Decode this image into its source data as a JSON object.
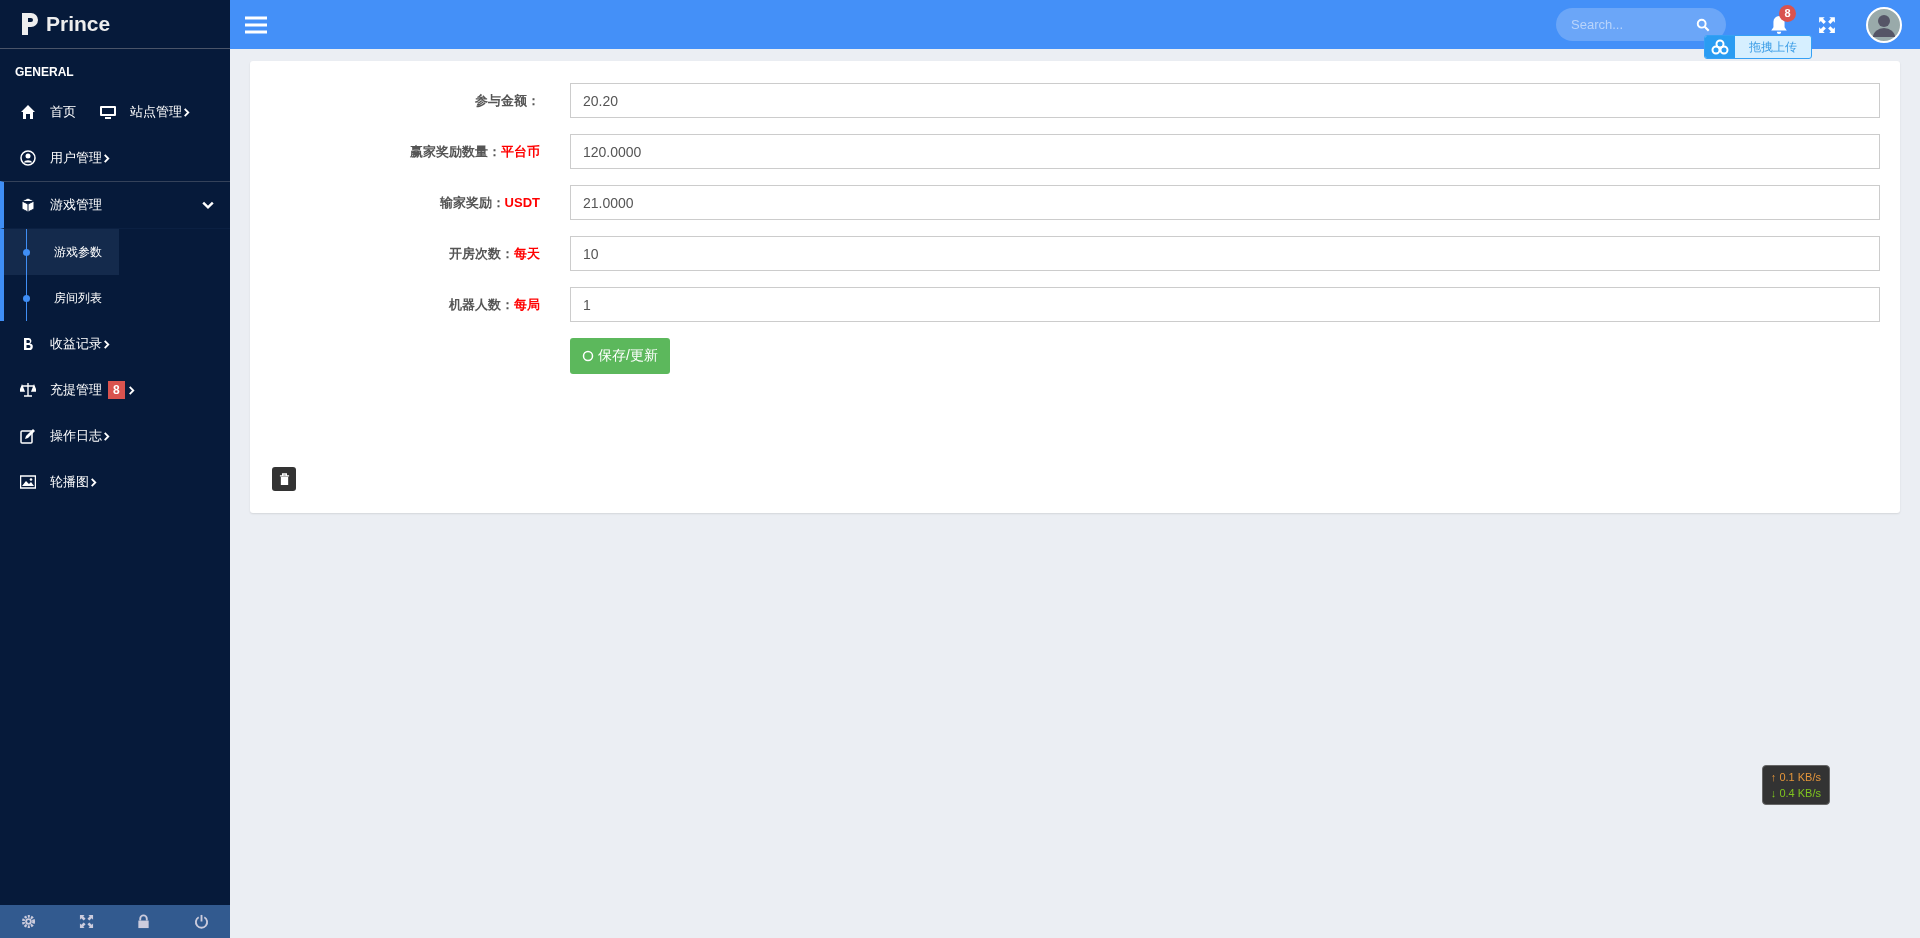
{
  "sidebar": {
    "brand": "Prince",
    "section": "GENERAL",
    "rows": [
      [
        {
          "label": "首页",
          "expanded": false,
          "arrow": false
        },
        {
          "label": "站点管理",
          "expanded": false,
          "arrow": true
        }
      ],
      [
        {
          "label": "用户管理",
          "expanded": false,
          "arrow": true
        }
      ],
      [
        {
          "label": "游戏管理",
          "expanded": true,
          "arrow": true,
          "children": [
            {
              "label": "游戏参数",
              "selected": true
            },
            {
              "label": "房间列表",
              "selected": false
            }
          ]
        }
      ],
      [
        {
          "label": "收益记录",
          "expanded": false,
          "arrow": true
        }
      ],
      [
        {
          "label": "充提管理",
          "expanded": false,
          "arrow": true,
          "badge": "8"
        }
      ],
      [
        {
          "label": "操作日志",
          "expanded": false,
          "arrow": true
        }
      ],
      [
        {
          "label": "轮播图",
          "expanded": false,
          "arrow": true
        }
      ]
    ]
  },
  "topbar": {
    "search": {
      "placeholder": "Search..."
    },
    "notification_badge": "8"
  },
  "upload_widget": {
    "label": "拖拽上传"
  },
  "form": {
    "fields": [
      {
        "label": "参与金额：",
        "value": "20.20"
      },
      {
        "label": "赢家奖励数量：",
        "unit": "平台币",
        "value": "120.0000"
      },
      {
        "label": "输家奖励：",
        "unit": "USDT",
        "value": "21.0000"
      },
      {
        "label": "开房次数：",
        "unit": "每天",
        "value": "10"
      },
      {
        "label": "机器人数：",
        "unit": "每局",
        "value": "1"
      }
    ],
    "submit": "保存/更新"
  },
  "speed_meter": {
    "upload": "↑ 0.1 KB/s",
    "download": "↓ 0.4 KB/s"
  }
}
